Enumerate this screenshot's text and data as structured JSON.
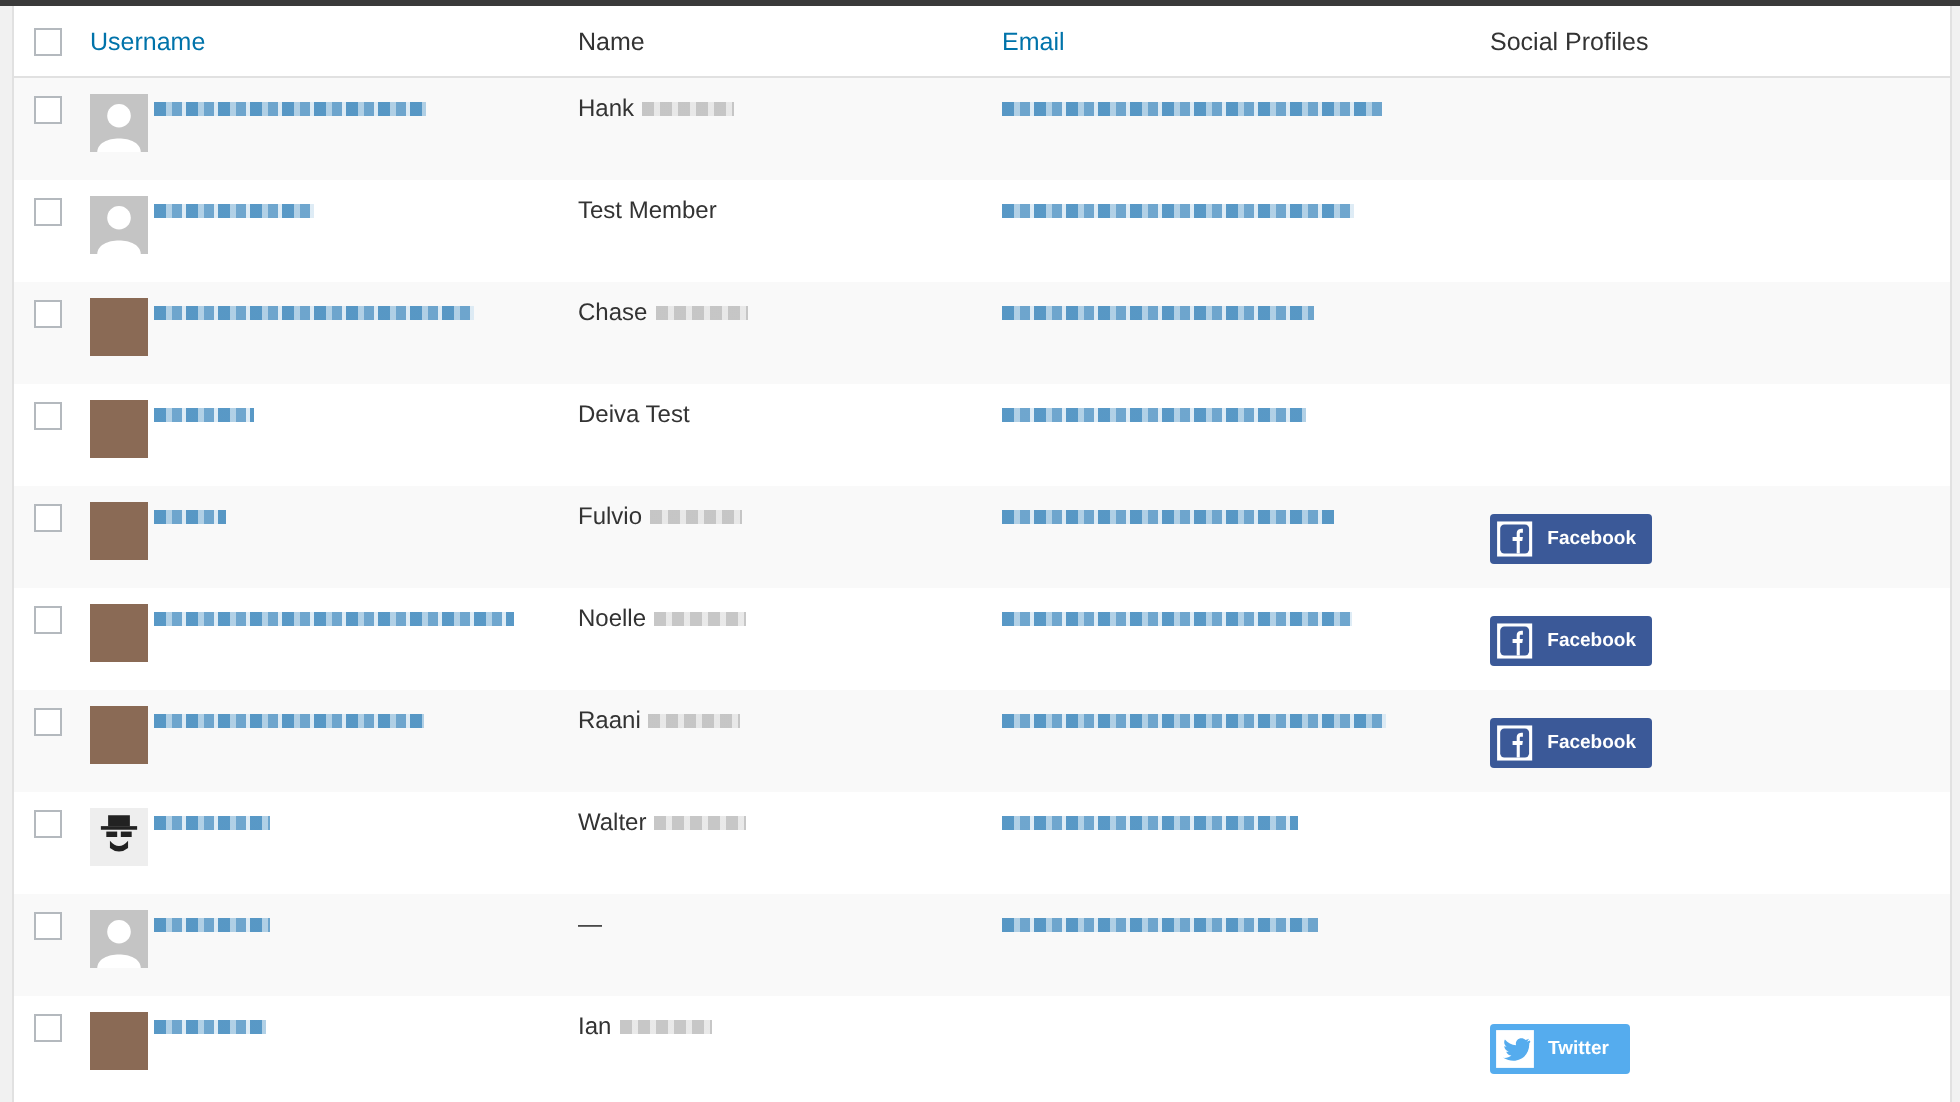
{
  "table": {
    "select_all": {
      "checked": false
    },
    "columns": [
      {
        "label": "Username",
        "sortable": true
      },
      {
        "label": "Name",
        "sortable": false
      },
      {
        "label": "Email",
        "sortable": true
      },
      {
        "label": "Social Profiles",
        "sortable": false
      }
    ],
    "rows": [
      {
        "checked": false,
        "avatar": {
          "kind": "default"
        },
        "name": "Hank",
        "name_redacted": true,
        "email_shown": true,
        "profiles": []
      },
      {
        "checked": false,
        "avatar": {
          "kind": "default"
        },
        "name": "Test Member",
        "name_redacted": false,
        "email_shown": true,
        "profiles": []
      },
      {
        "checked": false,
        "avatar": {
          "kind": "photo"
        },
        "name": "Chase",
        "name_redacted": true,
        "email_shown": true,
        "profiles": []
      },
      {
        "checked": false,
        "avatar": {
          "kind": "photo"
        },
        "name": "Deiva Test",
        "name_redacted": false,
        "email_shown": true,
        "profiles": []
      },
      {
        "checked": false,
        "avatar": {
          "kind": "photo"
        },
        "name": "Fulvio",
        "name_redacted": true,
        "email_shown": true,
        "profiles": [
          {
            "kind": "facebook",
            "label": "Facebook"
          }
        ]
      },
      {
        "checked": false,
        "avatar": {
          "kind": "photo"
        },
        "name": "Noelle",
        "name_redacted": true,
        "email_shown": true,
        "profiles": [
          {
            "kind": "facebook",
            "label": "Facebook"
          }
        ]
      },
      {
        "checked": false,
        "avatar": {
          "kind": "photo"
        },
        "name": "Raani",
        "name_redacted": true,
        "email_shown": true,
        "profiles": [
          {
            "kind": "facebook",
            "label": "Facebook"
          }
        ]
      },
      {
        "checked": false,
        "avatar": {
          "kind": "icon"
        },
        "name": "Walter",
        "name_redacted": true,
        "email_shown": true,
        "profiles": []
      },
      {
        "checked": false,
        "avatar": {
          "kind": "default"
        },
        "name": "—",
        "name_redacted": false,
        "email_shown": true,
        "profiles": []
      },
      {
        "checked": false,
        "avatar": {
          "kind": "photo"
        },
        "name": "Ian",
        "name_redacted": true,
        "email_shown": false,
        "profiles": [
          {
            "kind": "twitter",
            "label": "Twitter"
          }
        ]
      }
    ]
  }
}
